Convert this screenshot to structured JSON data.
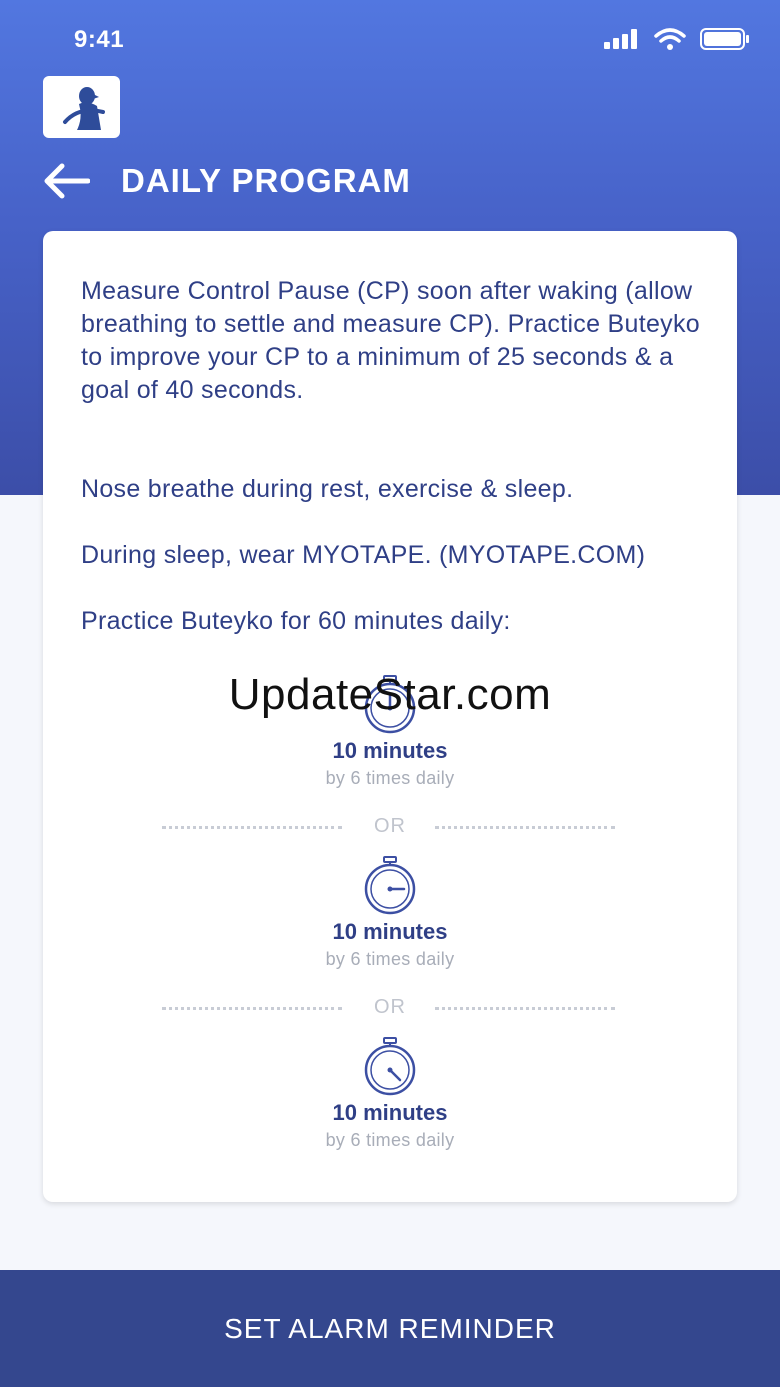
{
  "status": {
    "time": "9:41"
  },
  "header": {
    "title": "DAILY PROGRAM"
  },
  "card": {
    "paragraphs": [
      "Measure Control Pause (CP) soon after waking (allow breathing to settle and measure CP). Practice Buteyko to improve your CP to a minimum of 25 seconds & a goal of 40 seconds.",
      "Nose breathe during rest, exercise & sleep.",
      "During sleep, wear MYOTAPE. (MYOTAPE.COM)",
      "Practice Buteyko for 60 minutes daily:"
    ],
    "timers": [
      {
        "main": "10 minutes",
        "sub": "by 6 times daily"
      },
      {
        "main": "10 minutes",
        "sub": "by 6 times daily"
      },
      {
        "main": "10 minutes",
        "sub": "by 6 times daily"
      }
    ],
    "separator": "OR"
  },
  "watermark": "UpdateStar.com",
  "footer": {
    "button_label": "SET ALARM REMINDER"
  },
  "colors": {
    "header_top": "#5277e0",
    "header_bottom": "#3c4ea8",
    "text": "#2f3f86",
    "button": "#34478e"
  },
  "icons": [
    "signal-icon",
    "wifi-icon",
    "battery-icon",
    "app-logo",
    "back-arrow-icon",
    "stopwatch-icon"
  ]
}
